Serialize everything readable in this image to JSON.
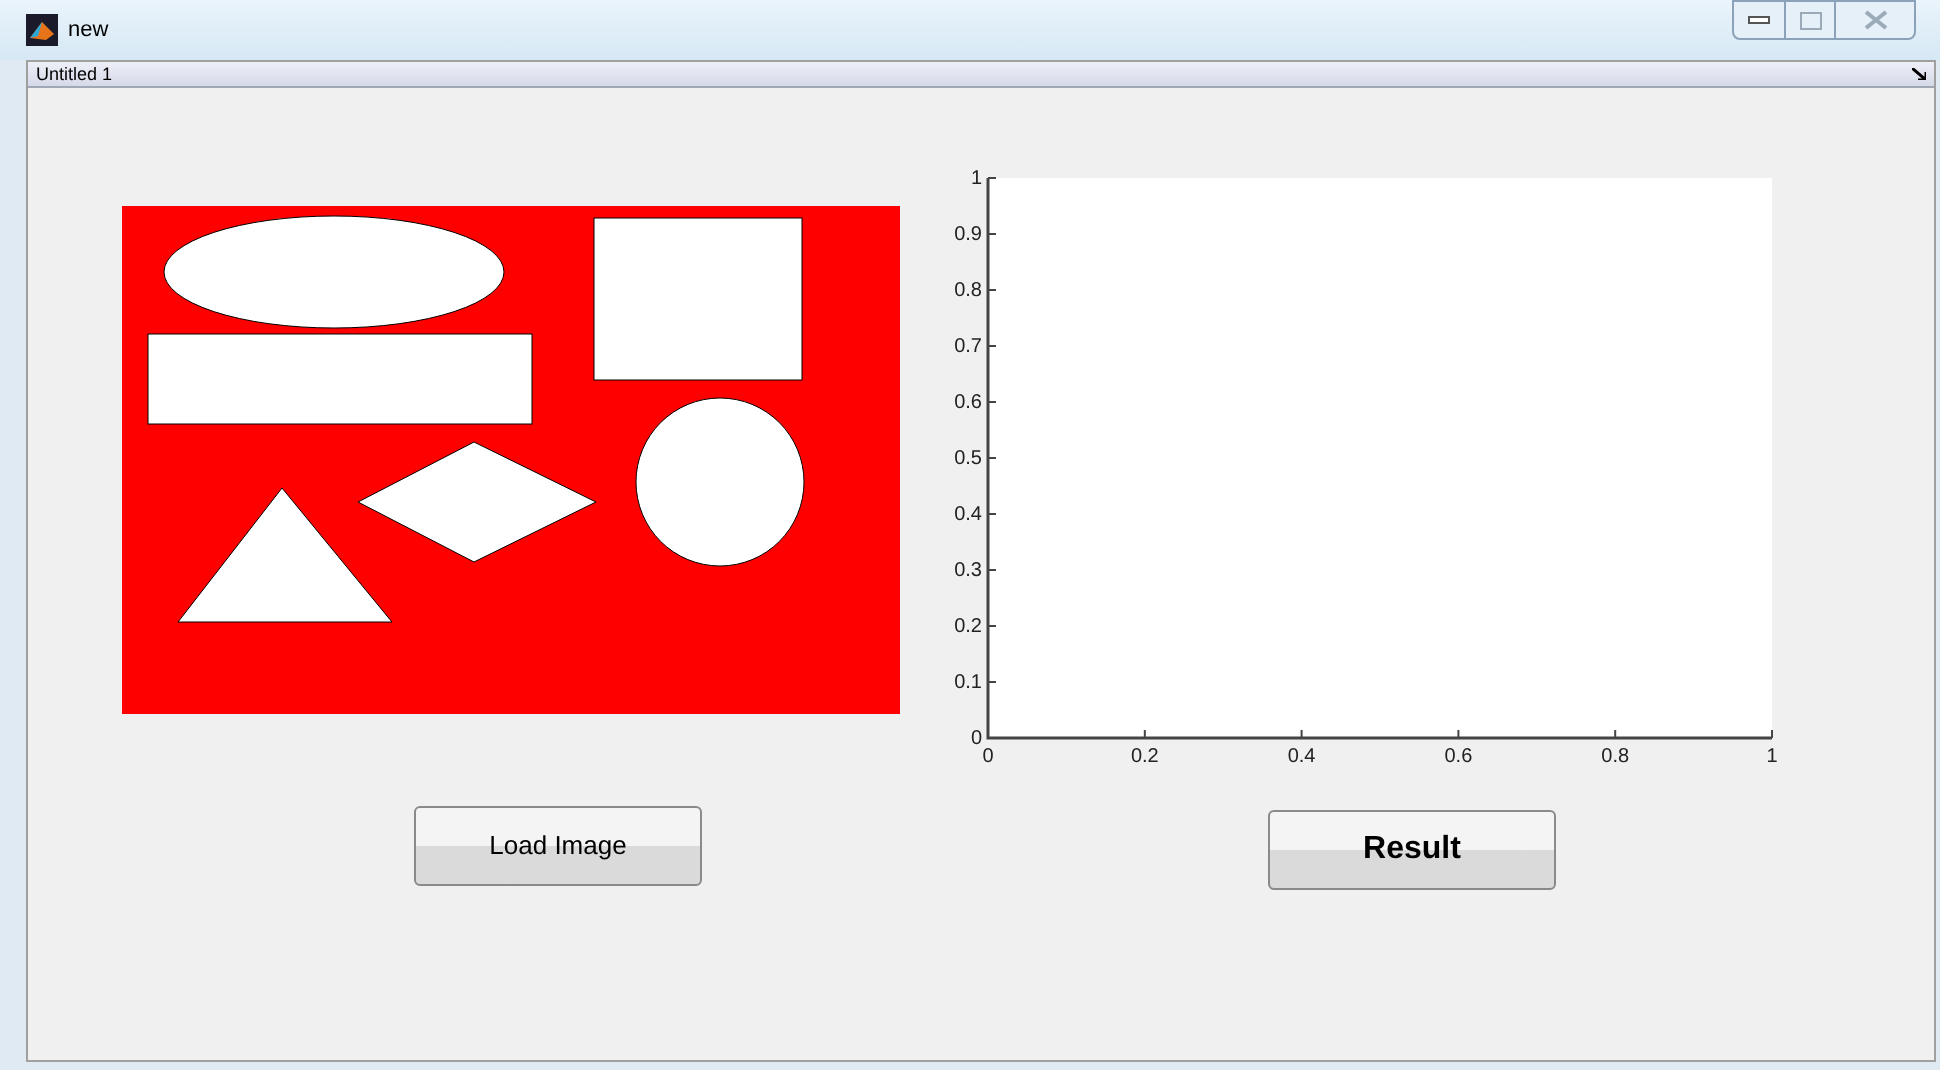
{
  "window": {
    "title": "new"
  },
  "panel": {
    "title": "Untitled 1"
  },
  "axes": {
    "chart_data": {
      "type": "line",
      "xlim": [
        0,
        1
      ],
      "ylim": [
        0,
        1
      ],
      "xticks": [
        {
          "value": 0,
          "label": "0"
        },
        {
          "value": 0.2,
          "label": "0.2"
        },
        {
          "value": 0.4,
          "label": "0.4"
        },
        {
          "value": 0.6,
          "label": "0.6"
        },
        {
          "value": 0.8,
          "label": "0.8"
        },
        {
          "value": 1,
          "label": "1"
        }
      ],
      "yticks": [
        {
          "value": 0,
          "label": "0"
        },
        {
          "value": 0.1,
          "label": "0.1"
        },
        {
          "value": 0.2,
          "label": "0.2"
        },
        {
          "value": 0.3,
          "label": "0.3"
        },
        {
          "value": 0.4,
          "label": "0.4"
        },
        {
          "value": 0.5,
          "label": "0.5"
        },
        {
          "value": 0.6,
          "label": "0.6"
        },
        {
          "value": 0.7,
          "label": "0.7"
        },
        {
          "value": 0.8,
          "label": "0.8"
        },
        {
          "value": 0.9,
          "label": "0.9"
        },
        {
          "value": 1,
          "label": "1"
        }
      ]
    }
  },
  "buttons": [
    {
      "label": "Load Image",
      "bold": false
    },
    {
      "label": "Result",
      "bold": true
    }
  ]
}
